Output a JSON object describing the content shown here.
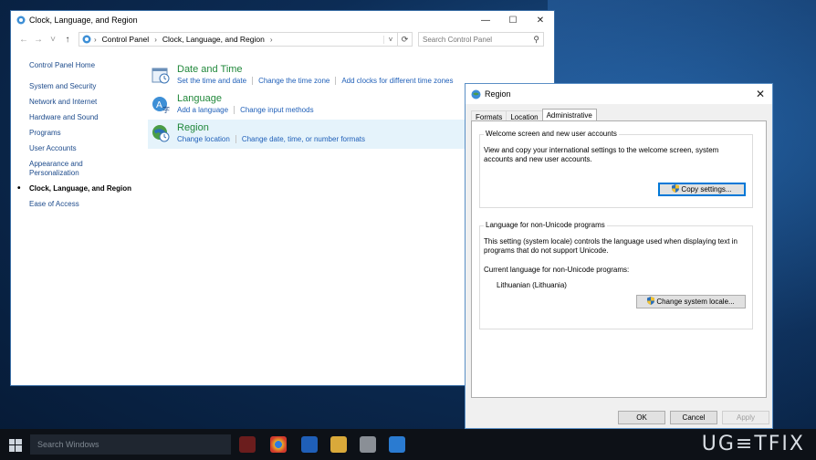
{
  "cp": {
    "title": "Clock, Language, and Region",
    "breadcrumb": [
      "Control Panel",
      "Clock, Language, and Region"
    ],
    "search_placeholder": "Search Control Panel",
    "left_nav": [
      "Control Panel Home",
      "System and Security",
      "Network and Internet",
      "Hardware and Sound",
      "Programs",
      "User Accounts",
      "Appearance and Personalization",
      "Clock, Language, and Region",
      "Ease of Access"
    ],
    "categories": [
      {
        "title": "Date and Time",
        "links": [
          "Set the time and date",
          "Change the time zone",
          "Add clocks for different time zones"
        ]
      },
      {
        "title": "Language",
        "links": [
          "Add a language",
          "Change input methods"
        ]
      },
      {
        "title": "Region",
        "links": [
          "Change location",
          "Change date, time, or number formats"
        ]
      }
    ]
  },
  "region": {
    "title": "Region",
    "tabs": [
      "Formats",
      "Location",
      "Administrative"
    ],
    "welcome": {
      "legend": "Welcome screen and new user accounts",
      "text": "View and copy your international settings to the welcome screen, system accounts and new user accounts.",
      "button": "Copy settings..."
    },
    "unicode": {
      "legend": "Language for non-Unicode programs",
      "text": "This setting (system locale) controls the language used when displaying text in programs that do not support Unicode.",
      "current_label": "Current language for non-Unicode programs:",
      "current_value": "Lithuanian (Lithuania)",
      "button": "Change system locale..."
    },
    "buttons": {
      "ok": "OK",
      "cancel": "Cancel",
      "apply": "Apply"
    }
  },
  "taskbar": {
    "search_placeholder": "Search Windows"
  },
  "watermark": "UG≡TFIX"
}
